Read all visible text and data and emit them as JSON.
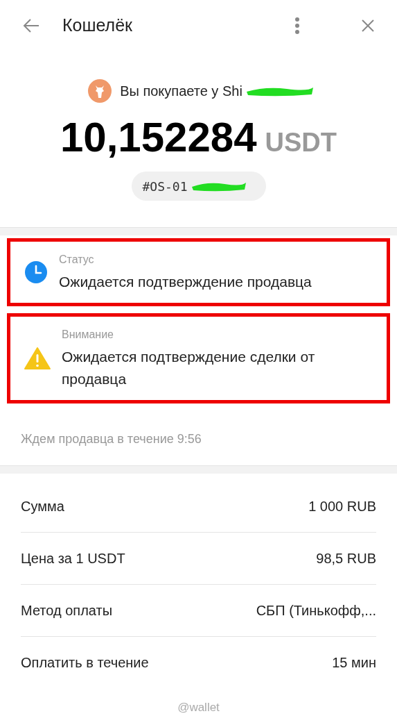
{
  "header": {
    "title": "Кошелёк"
  },
  "summary": {
    "seller_line": "Вы покупаете у Shi",
    "seller_redacted": true,
    "amount": "10,152284",
    "currency": "USDT",
    "order_id": "#OS-01",
    "order_redacted": true
  },
  "notices": [
    {
      "kind": "status",
      "label": "Статус",
      "text": "Ожидается подтверждение продавца",
      "highlighted": true
    },
    {
      "kind": "warning",
      "label": "Внимание",
      "text": "Ожидается подтверждение сделки от продавца",
      "highlighted": true
    }
  ],
  "timer_note": "Ждем продавца в течение 9:56",
  "details": [
    {
      "label": "Сумма",
      "value": "1 000 RUB"
    },
    {
      "label": "Цена за 1 USDT",
      "value": "98,5 RUB"
    },
    {
      "label": "Метод оплаты",
      "value": "СБП (Тинькофф,..."
    },
    {
      "label": "Оплатить в течение",
      "value": "15 мин"
    }
  ],
  "footer": "@wallet"
}
